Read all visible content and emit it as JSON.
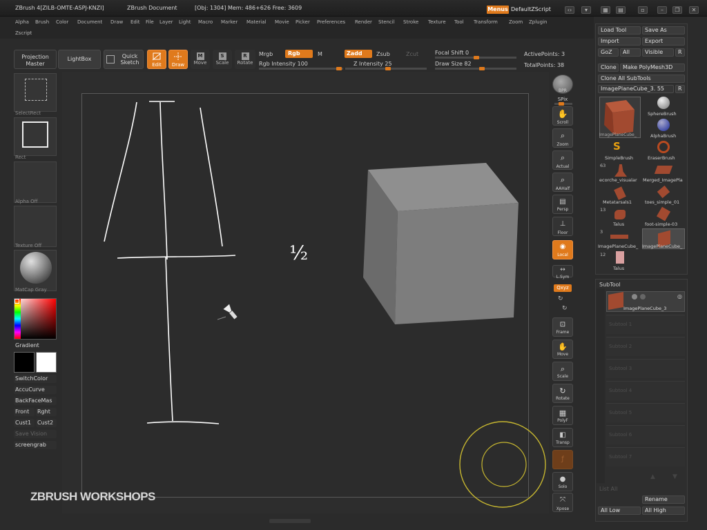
{
  "titlebar": {
    "app": "ZBrush 4[ZILB-OMTE-ASPJ-KNZI]",
    "document": "ZBrush Document",
    "stats": "[Obj: 1304] Mem: 486+626 Free: 3609",
    "menus_btn": "Menus",
    "script": "DefaultZScript"
  },
  "menubar": {
    "row1": [
      "Alpha",
      "Brush",
      "Color",
      "Document",
      "Draw",
      "Edit",
      "File",
      "Layer",
      "Light",
      "Macro",
      "Marker",
      "Material",
      "Movie",
      "Picker",
      "Preferences",
      "Render",
      "Stencil",
      "Stroke",
      "Texture",
      "Tool",
      "Transform",
      "Zoom",
      "Zplugin"
    ],
    "row2": [
      "Zscript"
    ]
  },
  "toolbar": {
    "projection_master": "Projection Master",
    "lightbox": "LightBox",
    "quick_sketch": "Quick Sketch",
    "edit": "Edit",
    "draw": "Draw",
    "move": "Move",
    "scale": "Scale",
    "rotate": "Rotate",
    "mrgb": "Mrgb",
    "rgb": "Rgb",
    "m": "M",
    "rgb_intensity": "Rgb Intensity 100",
    "zadd": "Zadd",
    "zsub": "Zsub",
    "zcut": "Zcut",
    "z_intensity": "Z Intensity 25",
    "focal_shift": "Focal Shift 0",
    "draw_size": "Draw Size 82",
    "active_points": "ActivePoints: 3",
    "total_points": "TotalPoints: 38"
  },
  "leftpanel": {
    "select_rect": "SelectRect",
    "rect": "Rect",
    "alpha": "Alpha Off",
    "texture": "Texture Off",
    "material": "MatCap Gray",
    "gradient": "Gradient",
    "switch_color": "SwitchColor",
    "accucurve": "AccuCurve",
    "backface": "BackFaceMas",
    "front": "Front",
    "right": "Rght",
    "cust1": "Cust1",
    "cust2": "Cust2",
    "save_vision": "Save Vision",
    "screengrab": "screengrab",
    "colors": {
      "main": "#000000",
      "secondary": "#ffffff"
    }
  },
  "canvas": {
    "annotation": "½",
    "watermark": "ZBRUSH WORKSHOPS"
  },
  "rightshelf": [
    "BPR",
    "SPix",
    "Scroll",
    "Zoom",
    "Actual",
    "AAHalf",
    "Persp",
    "Floor",
    "Local",
    "L.Sym",
    "Qxyz",
    "Frame",
    "Move",
    "Scale",
    "Rotate",
    "PolyF",
    "Transp",
    "Ghost",
    "Solo",
    "Xpose"
  ],
  "toolpalette": {
    "load_tool": "Load Tool",
    "save_as": "Save As",
    "import": "Import",
    "export": "Export",
    "goz": "GoZ",
    "all": "All",
    "visible": "Visible",
    "r": "R",
    "clone": "Clone",
    "make_polymesh": "Make PolyMesh3D",
    "clone_all": "Clone All SubTools",
    "current_tool": "ImagePlaneCube_3. 55",
    "tools": [
      {
        "name": "ImagePlaneCube_",
        "num": ""
      },
      {
        "name": "SphereBrush",
        "num": ""
      },
      {
        "name": "AlphaBrush",
        "num": ""
      },
      {
        "name": "SimpleBrush",
        "num": ""
      },
      {
        "name": "EraserBrush",
        "num": ""
      },
      {
        "name": "ecorche_visualar",
        "num": "63"
      },
      {
        "name": "Merged_ImagePla",
        "num": ""
      },
      {
        "name": "Metatarsals1",
        "num": ""
      },
      {
        "name": "toes_simple_01",
        "num": ""
      },
      {
        "name": "Talus",
        "num": "13"
      },
      {
        "name": "foot-simple-03",
        "num": ""
      },
      {
        "name": "ImagePlaneCube_",
        "num": "3"
      },
      {
        "name": "ImagePlaneCube_",
        "num": ""
      },
      {
        "name": "Talus",
        "num": "12"
      }
    ]
  },
  "subtool": {
    "title": "SubTool",
    "active": "ImagePlaneCube_3",
    "slots": [
      "Subtool 1",
      "Subtool 2",
      "Subtool 3",
      "Subtool 4",
      "Subtool 5",
      "Subtool 6",
      "Subtool 7"
    ],
    "list_all": "List All",
    "rename": "Rename",
    "all_low": "All Low",
    "all_high": "All High"
  }
}
